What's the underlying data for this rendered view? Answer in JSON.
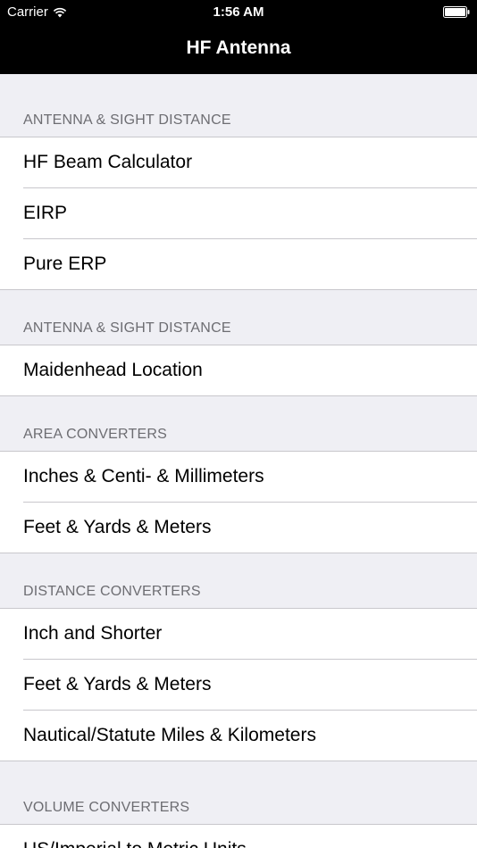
{
  "status": {
    "carrier": "Carrier",
    "time": "1:56 AM"
  },
  "nav": {
    "title": "HF Antenna"
  },
  "sections": [
    {
      "header": "ANTENNA & SIGHT DISTANCE",
      "items": [
        "HF Beam Calculator",
        "EIRP",
        "Pure ERP"
      ]
    },
    {
      "header": "ANTENNA & SIGHT DISTANCE",
      "items": [
        "Maidenhead Location"
      ]
    },
    {
      "header": "AREA CONVERTERS",
      "items": [
        "Inches & Centi- & Millimeters",
        "Feet & Yards & Meters"
      ]
    },
    {
      "header": "DISTANCE CONVERTERS",
      "items": [
        "Inch and Shorter",
        "Feet & Yards & Meters",
        "Nautical/Statute Miles & Kilometers"
      ]
    },
    {
      "header": "VOLUME CONVERTERS",
      "items": [
        "US/Imperial to Metric Units"
      ]
    }
  ],
  "icons": {
    "wifi": "wifi-icon",
    "battery": "battery-icon"
  }
}
